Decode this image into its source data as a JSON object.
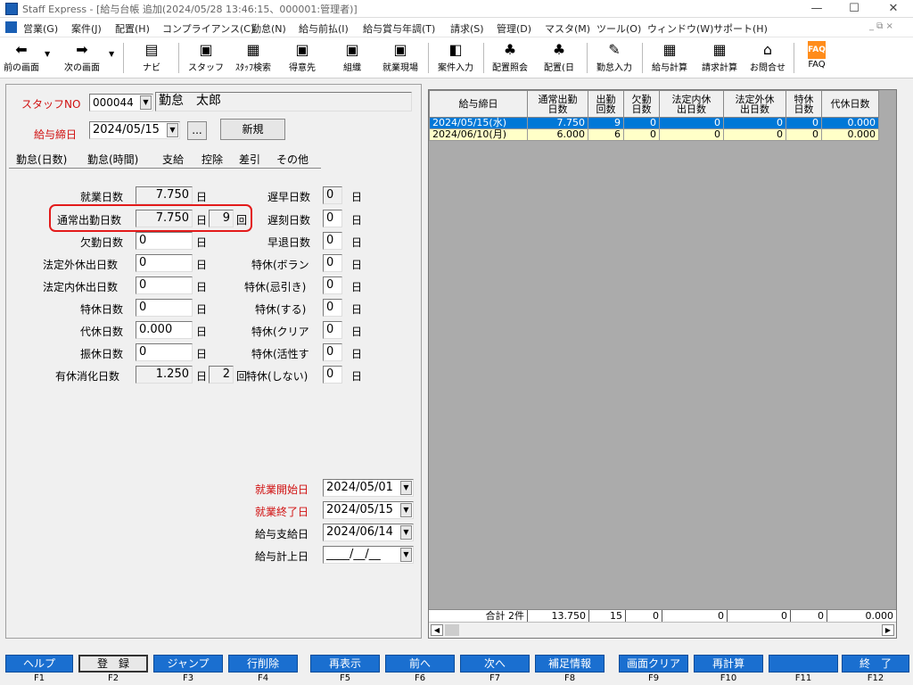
{
  "window": {
    "title": "Staff Express - [給与台帳 追加(2024/05/28 13:46:15、000001:管理者)]",
    "min": "—",
    "max": "☐",
    "close": "✕"
  },
  "menu": [
    "営業(G)",
    "案件(J)",
    "配置(H)",
    "コンプライアンス(C)",
    "勤怠(N)",
    "給与前払(I)",
    "給与賞与年調(T)",
    "請求(S)",
    "管理(D)",
    "マスタ(M)",
    "ツール(O)",
    "ウィンドウ(W)",
    "サポート(H)"
  ],
  "mdi_controls": "_ ⧉ ×",
  "toolbar": [
    {
      "icon": "back-arrow-icon",
      "label": "前の画面"
    },
    {
      "icon": "forward-arrow-icon",
      "label": "次の画面"
    },
    {
      "icon": "navi-icon",
      "label": "ナビ"
    },
    {
      "icon": "staff-icon",
      "label": "スタッフ"
    },
    {
      "icon": "staff-search-icon",
      "label": "ｽﾀｯﾌ検索"
    },
    {
      "icon": "client-icon",
      "label": "得意先"
    },
    {
      "icon": "organization-icon",
      "label": "組織"
    },
    {
      "icon": "worksite-icon",
      "label": "就業現場"
    },
    {
      "icon": "job-entry-icon",
      "label": "案件入力"
    },
    {
      "icon": "placement-inquiry-icon",
      "label": "配置照会"
    },
    {
      "icon": "placement-icon",
      "label": "配置(日"
    },
    {
      "icon": "attendance-input-icon",
      "label": "勤怠入力"
    },
    {
      "icon": "payroll-calc-icon",
      "label": "給与計算"
    },
    {
      "icon": "billing-calc-icon",
      "label": "請求計算"
    },
    {
      "icon": "inquiry-icon",
      "label": "お問合せ"
    },
    {
      "icon": "faq-icon",
      "label": "FAQ"
    }
  ],
  "form": {
    "staff_no_label": "スタッフNO",
    "staff_no": "000044",
    "staff_name": "勤怠　太郎",
    "pay_close_label": "給与締日",
    "pay_close_date": "2024/05/15",
    "ellipsis": "...",
    "new_button": "新規"
  },
  "tabs": [
    "勤怠(日数)",
    "勤怠(時間)",
    "支給",
    "控除",
    "差引",
    "その他"
  ],
  "left_fields": [
    {
      "label": "就業日数",
      "value": "7.750",
      "unit": "日"
    },
    {
      "label": "通常出勤日数",
      "value": "7.750",
      "unit": "日",
      "count": "9",
      "count_unit": "回"
    },
    {
      "label": "欠勤日数",
      "value": "0",
      "unit": "日"
    },
    {
      "label": "法定外休出日数",
      "value": "0",
      "unit": "日"
    },
    {
      "label": "法定内休出日数",
      "value": "0",
      "unit": "日"
    },
    {
      "label": "特休日数",
      "value": "0",
      "unit": "日"
    },
    {
      "label": "代休日数",
      "value": "0.000",
      "unit": "日"
    },
    {
      "label": "振休日数",
      "value": "0",
      "unit": "日"
    },
    {
      "label": "有休消化日数",
      "value": "1.250",
      "unit": "日",
      "count": "2",
      "count_unit": "回"
    }
  ],
  "right_fields": [
    {
      "label": "遅早日数",
      "value": "0",
      "unit": "日"
    },
    {
      "label": "遅刻日数",
      "value": "0",
      "unit": "日"
    },
    {
      "label": "早退日数",
      "value": "0",
      "unit": "日"
    },
    {
      "label": "特休(ボラン",
      "value": "0",
      "unit": "日"
    },
    {
      "label": "特休(忌引き)",
      "value": "0",
      "unit": "日"
    },
    {
      "label": "特休(する)",
      "value": "0",
      "unit": "日"
    },
    {
      "label": "特休(クリア",
      "value": "0",
      "unit": "日"
    },
    {
      "label": "特休(活性す",
      "value": "0",
      "unit": "日"
    },
    {
      "label": "特休(しない)",
      "value": "0",
      "unit": "日"
    }
  ],
  "dates": [
    {
      "label": "就業開始日",
      "value": "2024/05/01",
      "red": true
    },
    {
      "label": "就業終了日",
      "value": "2024/05/15",
      "red": true
    },
    {
      "label": "給与支給日",
      "value": "2024/06/14",
      "red": false
    },
    {
      "label": "給与計上日",
      "value": "____/__/__",
      "red": false
    }
  ],
  "grid": {
    "headers": [
      [
        "給与締日"
      ],
      [
        "通常出勤",
        "日数"
      ],
      [
        "出勤",
        "回数"
      ],
      [
        "欠勤",
        "日数"
      ],
      [
        "法定内休",
        "出日数"
      ],
      [
        "法定外休",
        "出日数"
      ],
      [
        "特休",
        "日数"
      ],
      [
        "代休日数"
      ]
    ],
    "rows": [
      [
        "2024/05/15(水)",
        "7.750",
        "9",
        "0",
        "0",
        "0",
        "0",
        "0.000"
      ],
      [
        "2024/06/10(月)",
        "6.000",
        "6",
        "0",
        "0",
        "0",
        "0",
        "0.000"
      ]
    ],
    "totals": [
      "合計 2件",
      "13.750",
      "15",
      "0",
      "0",
      "0",
      "0",
      "0.000"
    ]
  },
  "fkeys": [
    {
      "label": "ヘルプ",
      "key": "F1"
    },
    {
      "label": "登　録",
      "key": "F2"
    },
    {
      "label": "ジャンプ",
      "key": "F3"
    },
    {
      "label": "行削除",
      "key": "F4"
    },
    {
      "label": "再表示",
      "key": "F5"
    },
    {
      "label": "前へ",
      "key": "F6"
    },
    {
      "label": "次へ",
      "key": "F7"
    },
    {
      "label": "補足情報",
      "key": "F8"
    },
    {
      "label": "画面クリア",
      "key": "F9"
    },
    {
      "label": "再計算",
      "key": "F10"
    },
    {
      "label": "",
      "key": "F11"
    },
    {
      "label": "終　了",
      "key": "F12"
    }
  ]
}
